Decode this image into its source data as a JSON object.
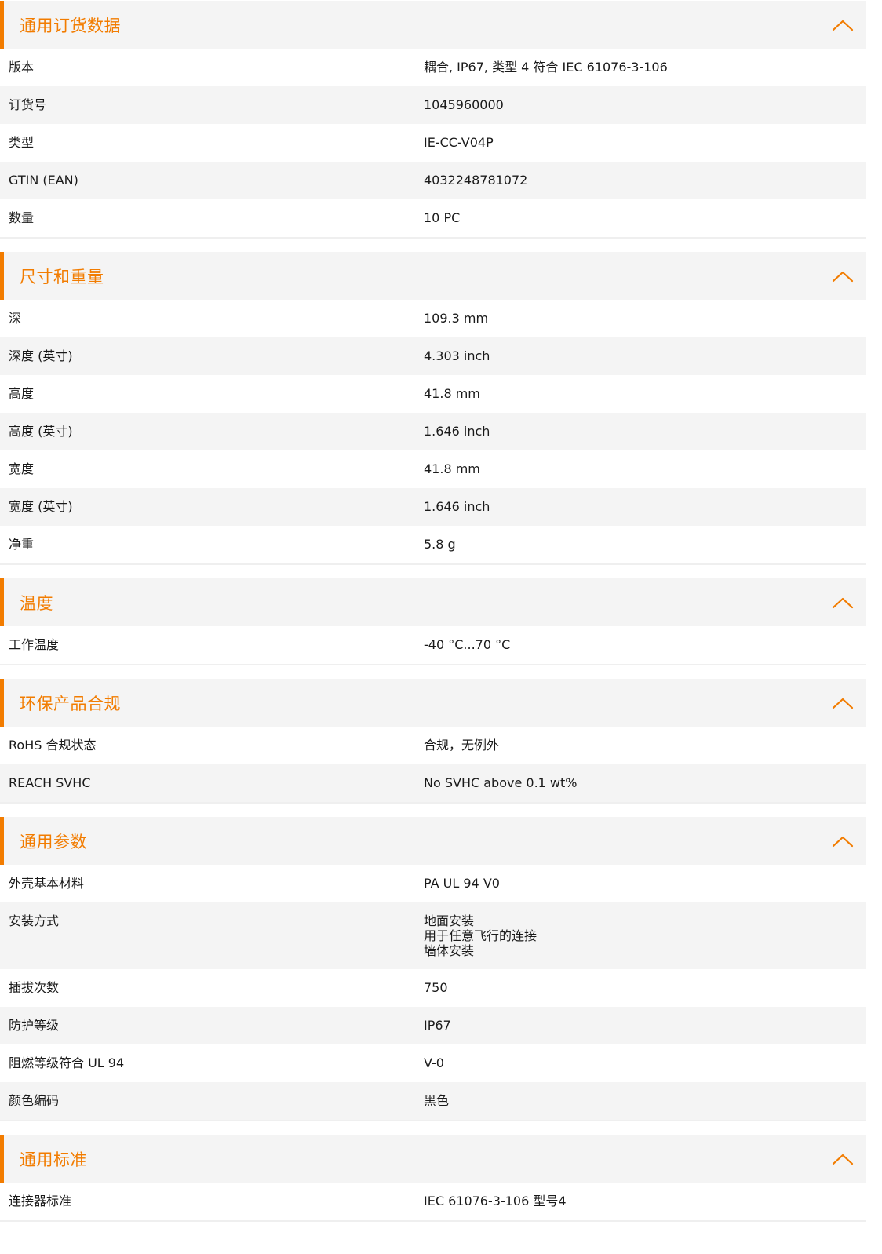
{
  "sections": [
    {
      "title": "通用订货数据",
      "rows": [
        {
          "label": "版本",
          "value": [
            "耦合, IP67, 类型 4 符合 IEC 61076-3-106"
          ]
        },
        {
          "label": "订货号",
          "value": [
            "1045960000"
          ]
        },
        {
          "label": "类型",
          "value": [
            "IE-CC-V04P"
          ]
        },
        {
          "label": "GTIN (EAN)",
          "value": [
            "4032248781072"
          ]
        },
        {
          "label": "数量",
          "value": [
            "10  PC"
          ]
        }
      ]
    },
    {
      "title": "尺寸和重量",
      "rows": [
        {
          "label": "深",
          "value": [
            "109.3  mm"
          ]
        },
        {
          "label": "深度 (英寸)",
          "value": [
            "4.303  inch"
          ]
        },
        {
          "label": "高度",
          "value": [
            "41.8  mm"
          ]
        },
        {
          "label": "高度 (英寸)",
          "value": [
            "1.646  inch"
          ]
        },
        {
          "label": "宽度",
          "value": [
            "41.8  mm"
          ]
        },
        {
          "label": "宽度 (英寸)",
          "value": [
            "1.646  inch"
          ]
        },
        {
          "label": "净重",
          "value": [
            "5.8  g"
          ]
        }
      ]
    },
    {
      "title": "温度",
      "rows": [
        {
          "label": "工作温度",
          "value": [
            "-40 °C...70 °C"
          ]
        }
      ]
    },
    {
      "title": "环保产品合规",
      "rows": [
        {
          "label": "RoHS 合规状态",
          "value": [
            "合规，无例外"
          ]
        },
        {
          "label": "REACH SVHC",
          "value": [
            "No SVHC above 0.1 wt%"
          ]
        }
      ]
    },
    {
      "title": "通用参数",
      "rows": [
        {
          "label": "外壳基本材料",
          "value": [
            "PA UL 94 V0"
          ]
        },
        {
          "label": "安装方式",
          "value": [
            "地面安装",
            "用于任意飞行的连接",
            "墙体安装"
          ]
        },
        {
          "label": "插拔次数",
          "value": [
            "750"
          ]
        },
        {
          "label": "防护等级",
          "value": [
            "IP67"
          ]
        },
        {
          "label": "阻燃等级符合 UL 94",
          "value": [
            "V-0"
          ]
        },
        {
          "label": "颜色编码",
          "value": [
            "黑色"
          ]
        }
      ]
    },
    {
      "title": "通用标准",
      "rows": [
        {
          "label": "连接器标准",
          "value": [
            "IEC 61076-3-106 型号4"
          ]
        }
      ]
    }
  ],
  "colors": {
    "accent": "#f27c00",
    "header_bg": "#f4f4f4",
    "row_alt_bg": "#f4f4f4",
    "text": "#1a1a1a"
  },
  "icons": {
    "section_toggle": "chevron-up-icon"
  }
}
